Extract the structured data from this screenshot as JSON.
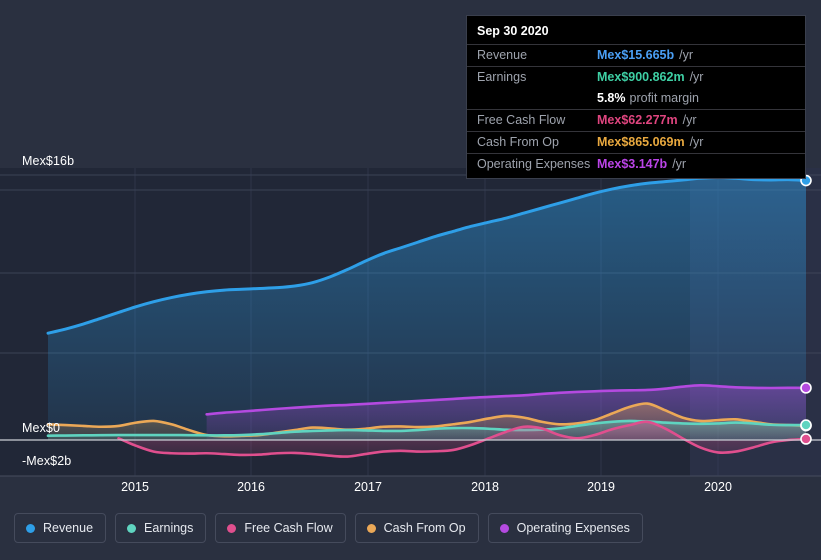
{
  "chart_data": {
    "type": "area",
    "title": "",
    "xlabel": "",
    "ylabel": "",
    "currency_prefix": "Mex$",
    "ylim": [
      -2000000000,
      16000000000
    ],
    "y_ticks": [
      {
        "label": "Mex$16b",
        "value": 16000000000
      },
      {
        "label": "Mex$0",
        "value": 0
      },
      {
        "label": "-Mex$2b",
        "value": -2000000000
      }
    ],
    "x_ticks": [
      "2015",
      "2016",
      "2017",
      "2018",
      "2019",
      "2020"
    ],
    "grid": true,
    "legend_position": "bottom",
    "series": [
      {
        "name": "Revenue",
        "color": "#2e9fe8",
        "values": [
          6.45,
          6.7,
          7.0,
          7.35,
          7.7,
          8.05,
          8.35,
          8.6,
          8.8,
          8.95,
          9.05,
          9.1,
          9.15,
          9.2,
          9.3,
          9.5,
          9.85,
          10.3,
          10.8,
          11.25,
          11.6,
          11.95,
          12.3,
          12.6,
          12.9,
          13.15,
          13.4,
          13.7,
          14.0,
          14.3,
          14.6,
          14.9,
          15.15,
          15.35,
          15.5,
          15.6,
          15.7,
          15.8,
          15.85,
          15.8,
          15.72,
          15.7,
          15.72,
          15.665
        ]
      },
      {
        "name": "Earnings",
        "color": "#5fd4c0",
        "values": [
          0.26,
          0.27,
          0.28,
          0.29,
          0.3,
          0.3,
          0.3,
          0.3,
          0.29,
          0.28,
          0.28,
          0.3,
          0.35,
          0.42,
          0.5,
          0.55,
          0.58,
          0.6,
          0.58,
          0.55,
          0.55,
          0.6,
          0.68,
          0.72,
          0.72,
          0.68,
          0.62,
          0.6,
          0.62,
          0.7,
          0.85,
          1.0,
          1.1,
          1.15,
          1.12,
          1.05,
          1.0,
          0.98,
          1.0,
          1.05,
          1.0,
          0.92,
          0.9,
          0.900862
        ]
      },
      {
        "name": "Free Cash Flow",
        "color": "#e04f8e",
        "values": [
          null,
          null,
          null,
          null,
          0.1,
          -0.35,
          -0.7,
          -0.8,
          -0.82,
          -0.8,
          -0.85,
          -0.9,
          -0.88,
          -0.8,
          -0.78,
          -0.85,
          -0.95,
          -1.0,
          -0.85,
          -0.7,
          -0.65,
          -0.7,
          -0.68,
          -0.6,
          -0.3,
          0.1,
          0.5,
          0.8,
          0.7,
          0.3,
          0.1,
          0.3,
          0.65,
          0.9,
          1.1,
          0.7,
          0.1,
          -0.45,
          -0.75,
          -0.7,
          -0.45,
          -0.15,
          0.0,
          0.062277
        ]
      },
      {
        "name": "Cash From Op",
        "color": "#eba857",
        "values": [
          0.95,
          0.9,
          0.85,
          0.8,
          0.85,
          1.05,
          1.15,
          0.95,
          0.6,
          0.3,
          0.22,
          0.25,
          0.3,
          0.45,
          0.6,
          0.75,
          0.7,
          0.62,
          0.68,
          0.8,
          0.82,
          0.78,
          0.82,
          0.95,
          1.1,
          1.3,
          1.45,
          1.35,
          1.1,
          0.95,
          1.0,
          1.2,
          1.6,
          2.0,
          2.2,
          1.8,
          1.35,
          1.15,
          1.2,
          1.25,
          1.1,
          0.95,
          0.9,
          0.865069
        ]
      },
      {
        "name": "Operating Expenses",
        "color": "#b44ae0",
        "values": [
          null,
          null,
          null,
          null,
          null,
          null,
          null,
          null,
          null,
          1.55,
          1.65,
          1.72,
          1.8,
          1.88,
          1.95,
          2.02,
          2.08,
          2.12,
          2.18,
          2.24,
          2.3,
          2.36,
          2.42,
          2.48,
          2.55,
          2.6,
          2.65,
          2.7,
          2.78,
          2.85,
          2.9,
          2.94,
          2.98,
          3.0,
          3.02,
          3.1,
          3.22,
          3.3,
          3.25,
          3.18,
          3.15,
          3.14,
          3.15,
          3.147
        ]
      }
    ]
  },
  "tooltip": {
    "date": "Sep 30 2020",
    "rows": [
      {
        "label": "Revenue",
        "value": "Mex$15.665b",
        "unit": "/yr",
        "color": "#4a9ff5"
      },
      {
        "label": "Earnings",
        "value": "Mex$900.862m",
        "unit": "/yr",
        "color": "#3ecfa4"
      },
      {
        "label": "",
        "value": "5.8%",
        "sub": "profit margin",
        "color": "#ffffff"
      },
      {
        "label": "Free Cash Flow",
        "value": "Mex$62.277m",
        "unit": "/yr",
        "color": "#e0457f"
      },
      {
        "label": "Cash From Op",
        "value": "Mex$865.069m",
        "unit": "/yr",
        "color": "#e9a93f"
      },
      {
        "label": "Operating Expenses",
        "value": "Mex$3.147b",
        "unit": "/yr",
        "color": "#bb44e8"
      }
    ]
  },
  "legend": {
    "items": [
      {
        "label": "Revenue",
        "color": "#2e9fe8"
      },
      {
        "label": "Earnings",
        "color": "#5fd4c0"
      },
      {
        "label": "Free Cash Flow",
        "color": "#e04f8e"
      },
      {
        "label": "Cash From Op",
        "color": "#eba857"
      },
      {
        "label": "Operating Expenses",
        "color": "#b44ae0"
      }
    ]
  },
  "axis": {
    "y_top_label": "Mex$16b",
    "y_zero_label": "Mex$0",
    "y_bottom_label": "-Mex$2b"
  }
}
